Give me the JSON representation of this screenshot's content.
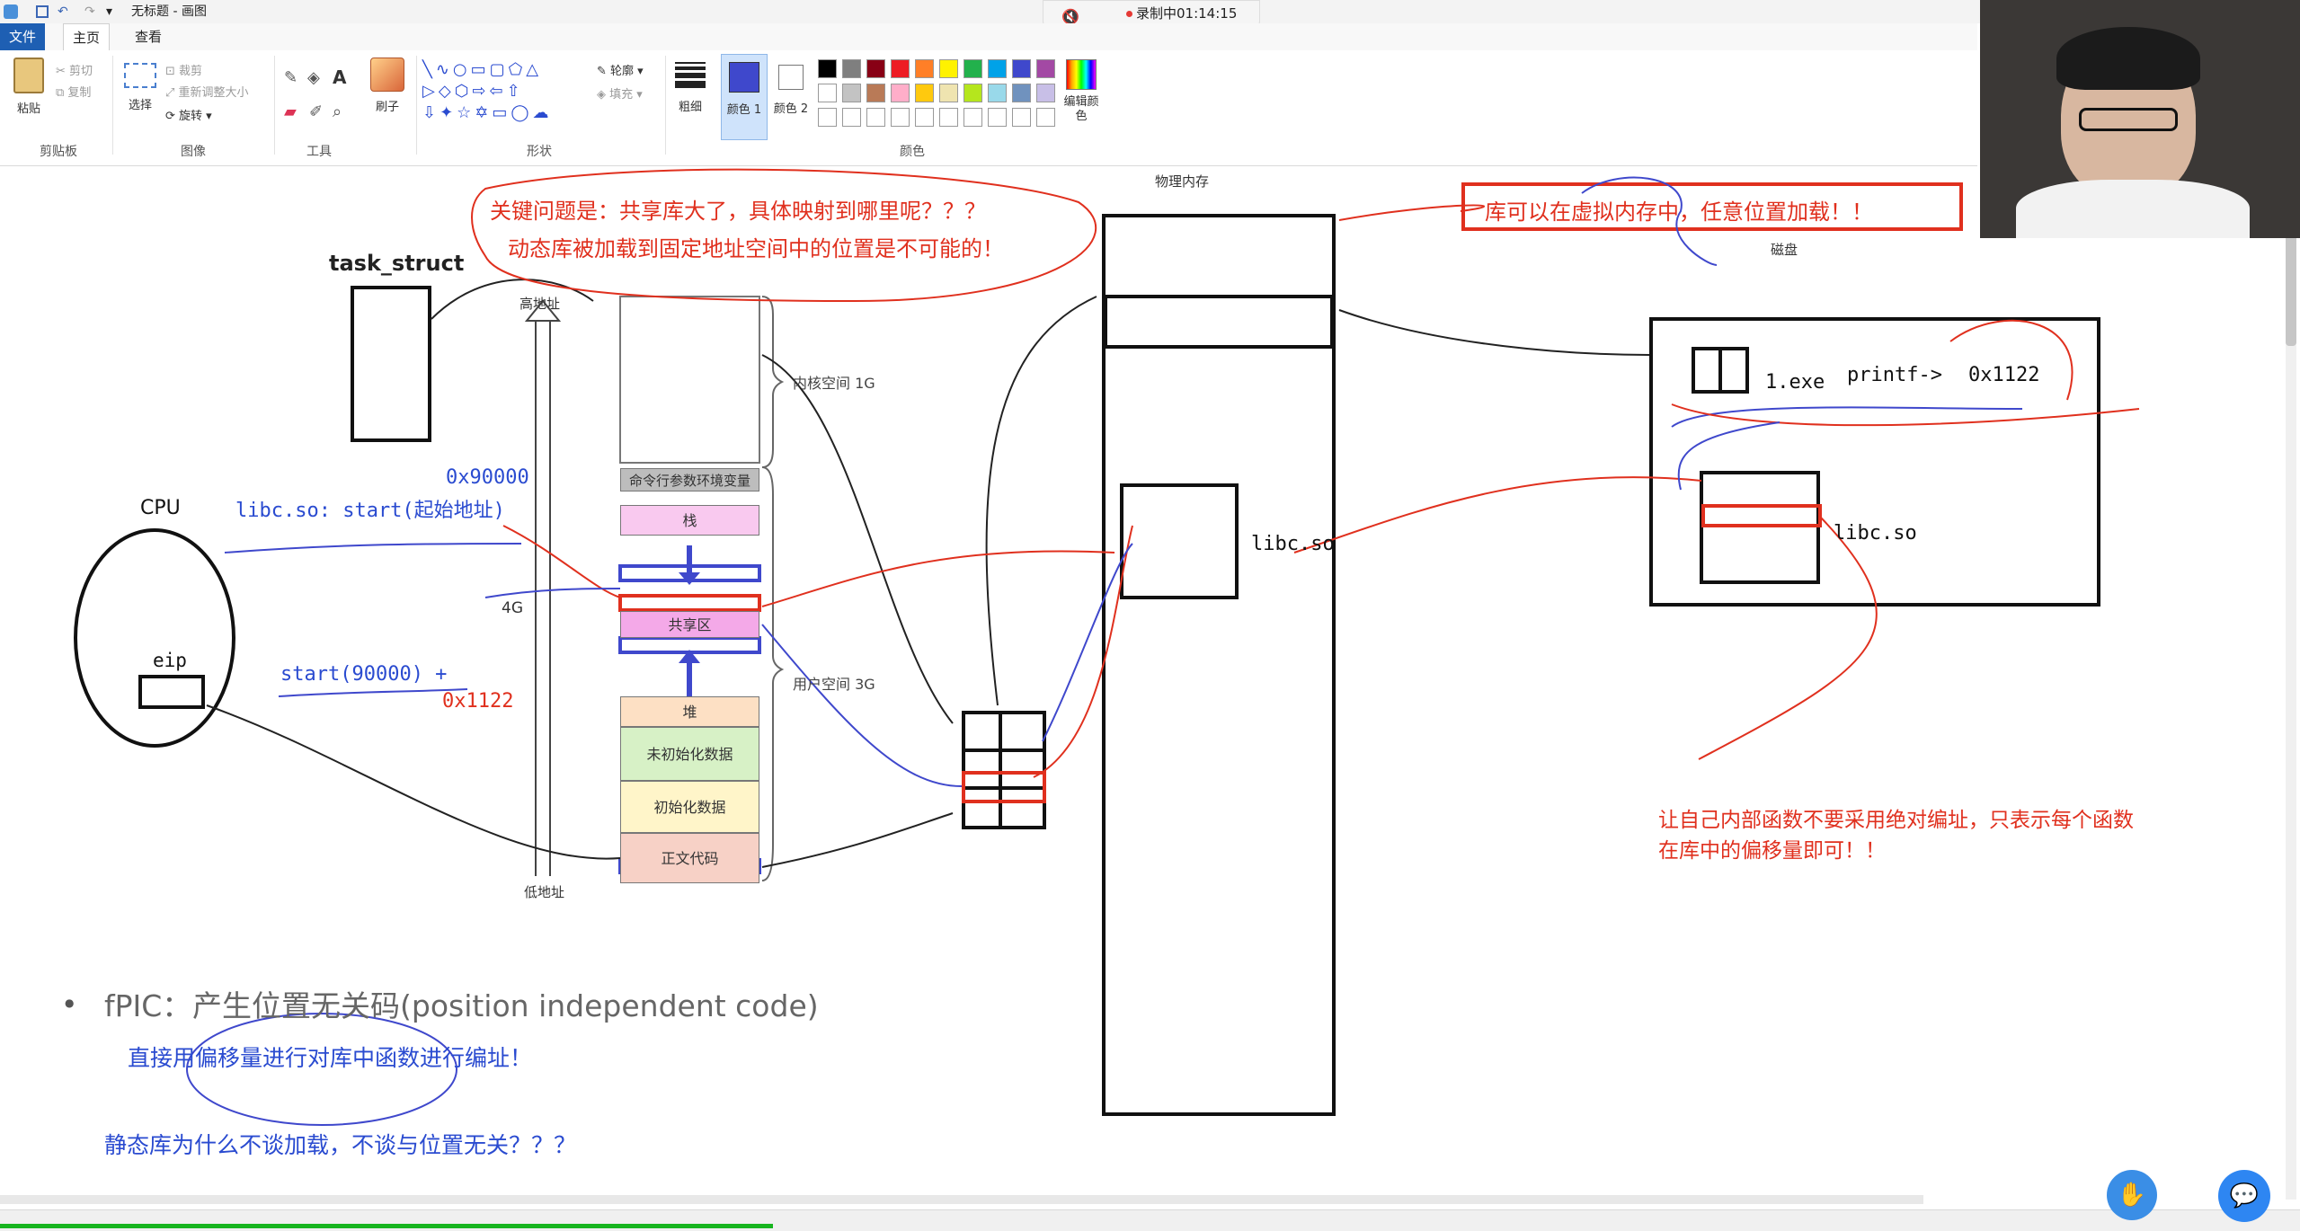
{
  "window": {
    "title": "无标题 - 画图",
    "recording": "录制中01:14:15"
  },
  "tabs": [
    "文件",
    "主页",
    "查看"
  ],
  "ribbon": {
    "clipboard": {
      "paste": "粘贴",
      "cut": "剪切",
      "copy": "复制",
      "label": "剪贴板"
    },
    "image": {
      "select": "选择",
      "crop": "裁剪",
      "resize": "重新调整大小",
      "rotate": "旋转",
      "label": "图像"
    },
    "tools": {
      "label": "工具"
    },
    "brush": {
      "label": "刷子"
    },
    "shapes": {
      "outline": "轮廓",
      "fill": "填充",
      "label": "形状"
    },
    "size": {
      "label": "粗细"
    },
    "color1": {
      "label": "颜色 1"
    },
    "color2": {
      "label": "颜色 2"
    },
    "colors": {
      "label": "颜色",
      "edit": "编辑颜色",
      "row1": [
        "#000000",
        "#7f7f7f",
        "#880015",
        "#ed1c24",
        "#ff7f27",
        "#fff200",
        "#22b14c",
        "#00a2e8",
        "#3f48cc",
        "#a349a4"
      ],
      "row2": [
        "#ffffff",
        "#c3c3c3",
        "#b97a57",
        "#ffaec9",
        "#ffc90e",
        "#efe4b0",
        "#b5e61d",
        "#99d9ea",
        "#7092be",
        "#c8bfe7"
      ]
    }
  },
  "drawing": {
    "task_struct": "task_struct",
    "high_addr": "高地址",
    "low_addr": "低地址",
    "cpu": "CPU",
    "eip": "eip",
    "size_4g": "4G",
    "addr_90000": "0x90000",
    "libc_start": "libc.so: start(起始地址)",
    "start_expr": "start(90000) +",
    "offset_1122": "0x1122",
    "kernel_space": "内核空间 1G",
    "user_space": "用户空间 3G",
    "segments": [
      "命令行参数环境变量",
      "栈",
      "共享区",
      "堆",
      "未初始化数据",
      "初始化数据",
      "正文代码"
    ],
    "phys_mem": "物理内存",
    "libc_so_phys": "libc.so",
    "disk": "磁盘",
    "exe": "1.exe",
    "printf_call": "printf->",
    "printf_addr": "0x1122",
    "libc_so_disk": "libc.so",
    "key_question_1": "关键问题是：共享库大了，具体映射到哪里呢？？？",
    "key_question_2": "动态库被加载到固定地址空间中的位置是不可能的！",
    "lib_anywhere": "库可以在虚拟内存中，任意位置加载！！",
    "offset_note_1": "让自己内部函数不要采用绝对编址，只表示每个函数",
    "offset_note_2": "在库中的偏移量即可！！",
    "fpic_prefix": "fPIC：",
    "fpic_text": "产生位置无关码(position independent code)",
    "fpic_note": "直接用偏移量进行对库中函数进行编址！",
    "static_q": "静态库为什么不谈加载，不谈与位置无关？？？"
  },
  "accent_colors": {
    "red": "#e0301e",
    "blue": "#2a4bd0",
    "ribbon_blue": "#1e5fb3"
  }
}
